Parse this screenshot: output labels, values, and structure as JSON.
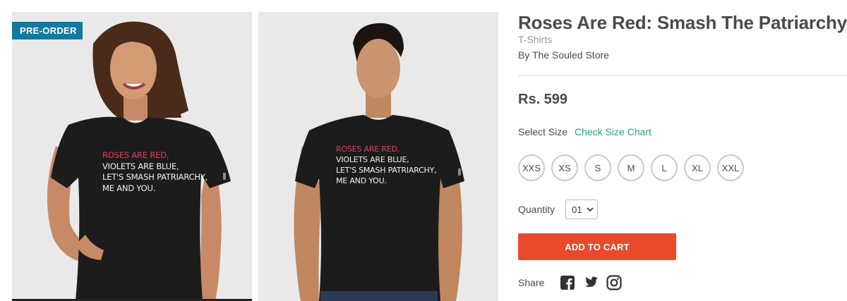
{
  "product": {
    "badge": "PRE-ORDER",
    "title": "Roses Are Red: Smash The Patriarchy",
    "category": "T-Shirts",
    "byline": "By The Souled Store",
    "price": "Rs. 599",
    "print_lines": [
      "ROSES ARE RED,",
      "VIOLETS ARE BLUE,",
      "LET'S SMASH PATRIARCHY,",
      "ME AND YOU."
    ]
  },
  "size_select": {
    "label": "Select Size",
    "chart_link": "Check Size Chart",
    "options": [
      "XXS",
      "XS",
      "S",
      "M",
      "L",
      "XL",
      "XXL"
    ]
  },
  "quantity": {
    "label": "Quantity",
    "value": "01"
  },
  "cart": {
    "button_label": "ADD TO CART",
    "color": "#e94a2c"
  },
  "share": {
    "label": "Share",
    "icons": [
      "facebook-icon",
      "twitter-icon",
      "instagram-icon"
    ]
  },
  "colors": {
    "badge": "#117a9e",
    "link": "#2a9d8f",
    "shirt": "#1c1c1c",
    "print_accent": "#e0405a"
  }
}
